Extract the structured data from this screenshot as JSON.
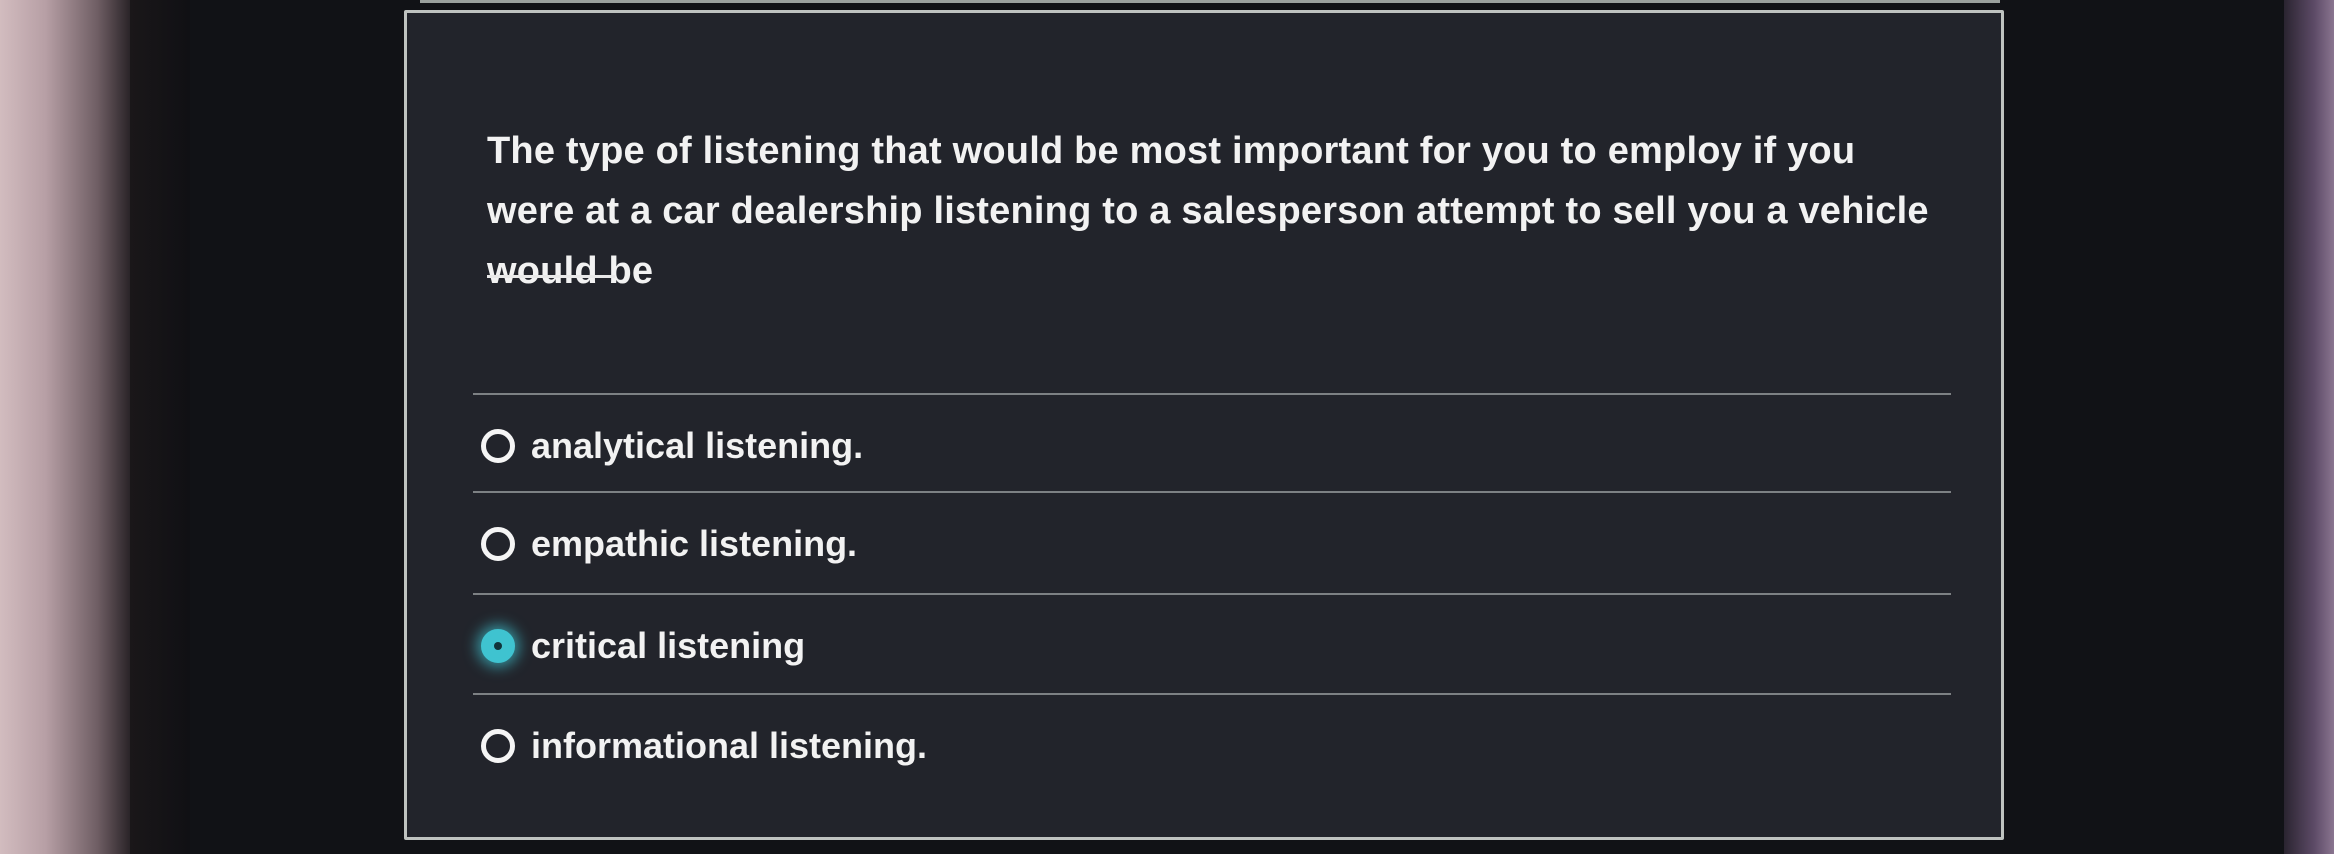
{
  "question": {
    "text": "The type of listening that would be most important for you to employ if you were at a car dealership listening to a salesperson attempt to sell you a vehicle would be"
  },
  "options": [
    {
      "label": "analytical listening.",
      "selected": false
    },
    {
      "label": "empathic listening.",
      "selected": false
    },
    {
      "label": "critical listening",
      "selected": true
    },
    {
      "label": "informational listening.",
      "selected": false
    }
  ],
  "colors": {
    "card_background": "#22242b",
    "text": "#f2f2f2",
    "selected_radio": "#3fc3d0"
  }
}
